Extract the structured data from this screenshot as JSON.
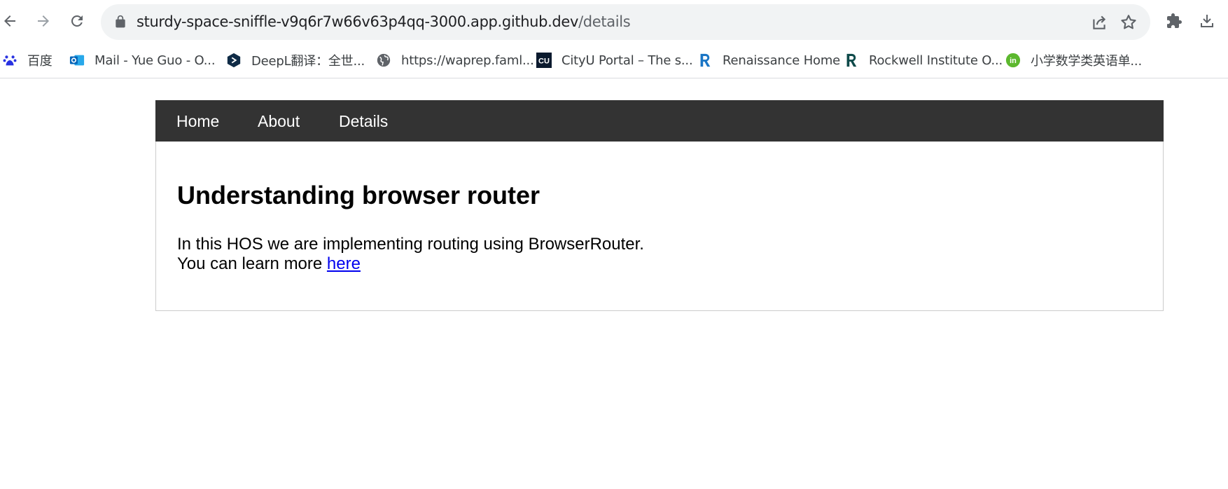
{
  "browser": {
    "url_main": "sturdy-space-sniffle-v9q6r7w66v63p4qq-3000.app.github.dev",
    "url_path": "/details",
    "bookmarks": [
      {
        "label": "百度",
        "icon": "baidu-paw-icon"
      },
      {
        "label": "Mail - Yue Guo - O...",
        "icon": "outlook-icon"
      },
      {
        "label": "DeepL翻译：全世...",
        "icon": "deepl-icon"
      },
      {
        "label": "https://waprep.faml...",
        "icon": "globe-icon"
      },
      {
        "label": "CityU Portal – The s...",
        "icon": "cityu-icon",
        "icon_text": "CU"
      },
      {
        "label": "Renaissance Home",
        "icon": "renaissance-icon"
      },
      {
        "label": "Rockwell Institute O...",
        "icon": "rockwell-icon"
      },
      {
        "label": "小学数学类英语单...",
        "icon": "in-icon",
        "icon_text": "in"
      }
    ]
  },
  "nav": {
    "items": [
      {
        "label": "Home"
      },
      {
        "label": "About"
      },
      {
        "label": "Details"
      }
    ]
  },
  "page": {
    "heading": "Understanding browser router",
    "line1": "In this HOS we are implementing routing using BrowserRouter.",
    "line2_prefix": "You can learn more ",
    "link_text": "here"
  },
  "colors": {
    "navbar_bg": "#333333",
    "link": "#0000ee",
    "omnibox_bg": "#f1f3f4"
  }
}
